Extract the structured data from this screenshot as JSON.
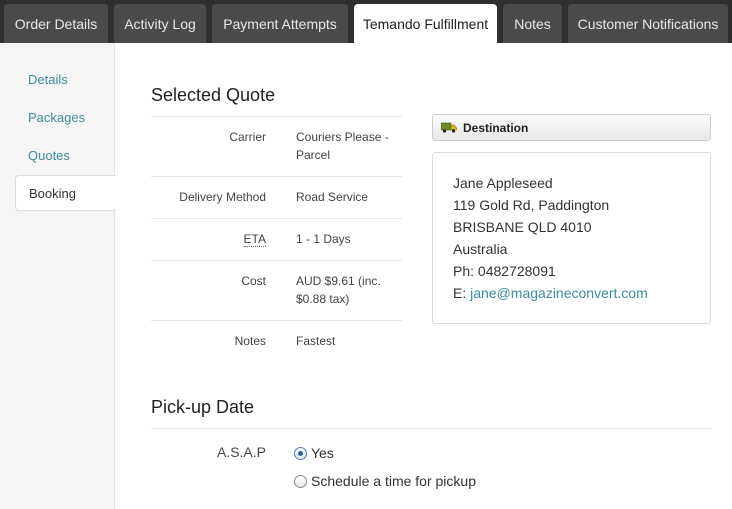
{
  "tabs": [
    {
      "label": "Order Details",
      "active": false
    },
    {
      "label": "Activity Log",
      "active": false
    },
    {
      "label": "Payment Attempts",
      "active": false
    },
    {
      "label": "Temando Fulfillment",
      "active": true
    },
    {
      "label": "Notes",
      "active": false
    },
    {
      "label": "Customer Notifications",
      "active": false
    }
  ],
  "sidenav": {
    "items": [
      {
        "label": "Details",
        "active": false
      },
      {
        "label": "Packages",
        "active": false
      },
      {
        "label": "Quotes",
        "active": false
      },
      {
        "label": "Booking",
        "active": true
      }
    ]
  },
  "selected_quote": {
    "title": "Selected Quote",
    "rows": [
      {
        "label": "Carrier",
        "value": "Couriers Please - Parcel"
      },
      {
        "label": "Delivery Method",
        "value": "Road Service"
      },
      {
        "label": "ETA",
        "value": "1 - 1 Days"
      },
      {
        "label": "Cost",
        "value": "AUD $9.61 (inc. $0.88 tax)"
      },
      {
        "label": "Notes",
        "value": "Fastest"
      }
    ]
  },
  "destination": {
    "header": "Destination",
    "name": "Jane Appleseed",
    "street": "119 Gold Rd, Paddington",
    "city_line": "BRISBANE QLD 4010",
    "country": "Australia",
    "phone": "Ph: 0482728091",
    "email_prefix": "E:",
    "email": "jane@magazineconvert.com"
  },
  "pickup": {
    "title": "Pick-up Date",
    "asap_label": "A.S.A.P",
    "options": [
      {
        "label": "Yes",
        "checked": true
      },
      {
        "label": "Schedule a time for pickup",
        "checked": false
      }
    ]
  },
  "colors": {
    "link": "#3c8c9c",
    "tabbar": "#2f2f2f",
    "tab": "#4a4a4a"
  }
}
